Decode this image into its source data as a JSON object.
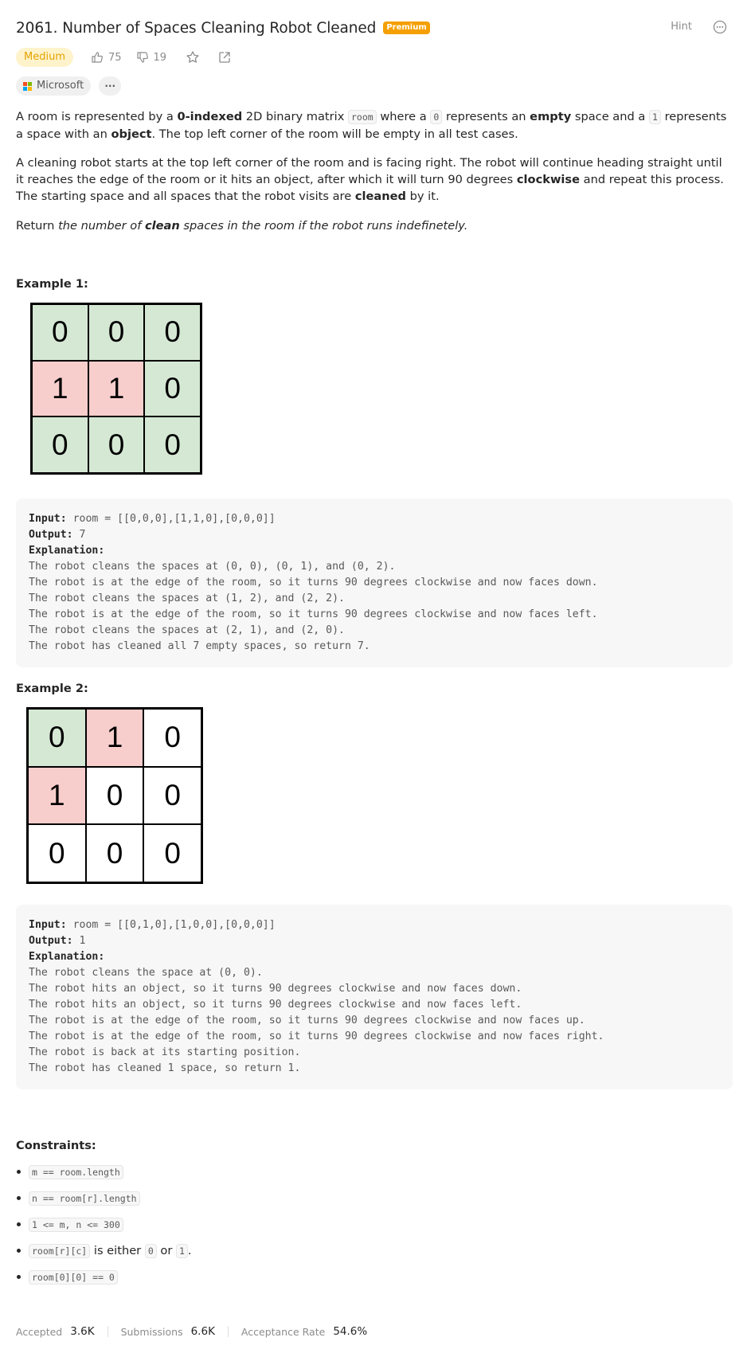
{
  "problem": {
    "title": "2061. Number of Spaces Cleaning Robot Cleaned",
    "premium_badge": "Premium",
    "hint_label": "Hint",
    "difficulty": "Medium",
    "likes": "75",
    "dislikes": "19",
    "company": "Microsoft",
    "more_tags": "···"
  },
  "description": {
    "p1_a": "A room is represented by a ",
    "p1_b": "0-indexed",
    "p1_c": " 2D binary matrix ",
    "p1_code1": "room",
    "p1_d": " where a ",
    "p1_code2": "0",
    "p1_e": " represents an ",
    "p1_f": "empty",
    "p1_g": " space and a ",
    "p1_code3": "1",
    "p1_h": " represents a space with an ",
    "p1_i": "object",
    "p1_j": ". The top left corner of the room will be empty in all test cases.",
    "p2_a": "A cleaning robot starts at the top left corner of the room and is facing right. The robot will continue heading straight until it reaches the edge of the room or it hits an object, after which it will turn 90 degrees ",
    "p2_b": "clockwise",
    "p2_c": " and repeat this process. The starting space and all spaces that the robot visits are ",
    "p2_d": "cleaned",
    "p2_e": " by it.",
    "p3_a": "Return ",
    "p3_b": "the number of ",
    "p3_c": "clean",
    "p3_d": " spaces in the room if the robot runs indefinetely."
  },
  "examples": [
    {
      "title": "Example 1:",
      "grid": [
        [
          "0",
          "0",
          "0"
        ],
        [
          "1",
          "1",
          "0"
        ],
        [
          "0",
          "0",
          "0"
        ]
      ],
      "input_label": "Input:",
      "input": " room = [[0,0,0],[1,1,0],[0,0,0]]",
      "output_label": "Output:",
      "output": " 7",
      "explanation_label": "Explanation:",
      "explanation": "The robot cleans the spaces at (0, 0), (0, 1), and (0, 2).\nThe robot is at the edge of the room, so it turns 90 degrees clockwise and now faces down.\nThe robot cleans the spaces at (1, 2), and (2, 2).\nThe robot is at the edge of the room, so it turns 90 degrees clockwise and now faces left.\nThe robot cleans the spaces at (2, 1), and (2, 0).\nThe robot has cleaned all 7 empty spaces, so return 7."
    },
    {
      "title": "Example 2:",
      "grid": [
        [
          "0",
          "1",
          "0"
        ],
        [
          "1",
          "0",
          "0"
        ],
        [
          "0",
          "0",
          "0"
        ]
      ],
      "input_label": "Input:",
      "input": " room = [[0,1,0],[1,0,0],[0,0,0]]",
      "output_label": "Output:",
      "output": " 1",
      "explanation_label": "Explanation:",
      "explanation": "The robot cleans the space at (0, 0).\nThe robot hits an object, so it turns 90 degrees clockwise and now faces down.\nThe robot hits an object, so it turns 90 degrees clockwise and now faces left.\nThe robot is at the edge of the room, so it turns 90 degrees clockwise and now faces up.\nThe robot is at the edge of the room, so it turns 90 degrees clockwise and now faces right.\nThe robot is back at its starting position.\nThe robot has cleaned 1 space, so return 1."
    }
  ],
  "colors": {
    "cleaned": "#d5e8d4",
    "object": "#f8cecc",
    "empty": "#ffffff",
    "difficulty_bg": "#fff3cc",
    "difficulty_text": "#e4a300",
    "premium": "#f59f00"
  },
  "constraints": {
    "title": "Constraints:",
    "c1": "m == room.length",
    "c2": "n == room[r].length",
    "c3": "1 <= m, n <= 300",
    "c4_code": "room[r][c]",
    "c4_text1": " is either ",
    "c4_code2": "0",
    "c4_text2": " or ",
    "c4_code3": "1",
    "c4_text3": ".",
    "c5": "room[0][0] == 0"
  },
  "stats": {
    "accepted_label": "Accepted",
    "accepted_value": "3.6K",
    "submissions_label": "Submissions",
    "submissions_value": "6.6K",
    "rate_label": "Acceptance Rate",
    "rate_value": "54.6%"
  }
}
